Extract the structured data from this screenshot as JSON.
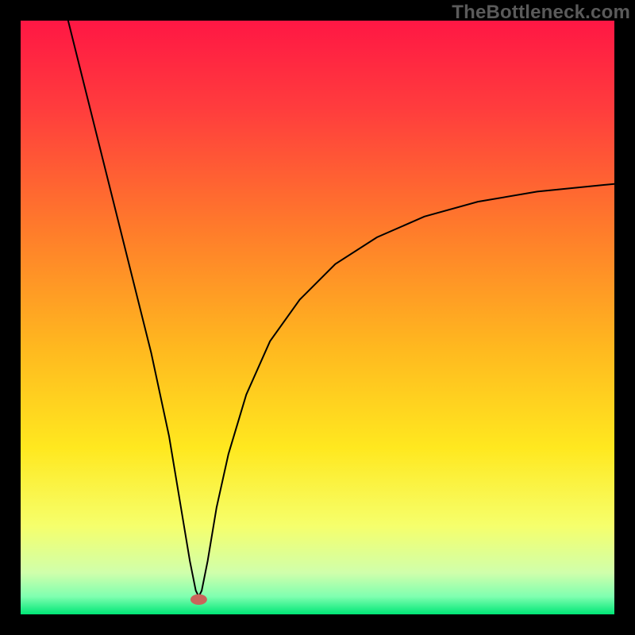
{
  "watermark": "TheBottleneck.com",
  "chart_data": {
    "type": "line",
    "title": "",
    "xlabel": "",
    "ylabel": "",
    "x_range": [
      0,
      100
    ],
    "y_range": [
      0,
      100
    ],
    "background": {
      "type": "vertical_gradient",
      "stops": [
        {
          "pos": 0.0,
          "color": "#ff1744"
        },
        {
          "pos": 0.15,
          "color": "#ff3d3d"
        },
        {
          "pos": 0.35,
          "color": "#ff7b2b"
        },
        {
          "pos": 0.55,
          "color": "#ffb81f"
        },
        {
          "pos": 0.72,
          "color": "#ffe81f"
        },
        {
          "pos": 0.85,
          "color": "#f6ff6b"
        },
        {
          "pos": 0.93,
          "color": "#d0ffab"
        },
        {
          "pos": 0.97,
          "color": "#7fffb0"
        },
        {
          "pos": 1.0,
          "color": "#00e676"
        }
      ]
    },
    "curve": {
      "note": "V-shaped curve; vertex near x≈30, y≈3. Left branch rises to top-left corner; right branch rises asymptotically toward ~70% height at right edge.",
      "points": [
        {
          "x": 8.0,
          "y": 100.0
        },
        {
          "x": 10.0,
          "y": 92.0
        },
        {
          "x": 13.0,
          "y": 80.0
        },
        {
          "x": 16.0,
          "y": 68.0
        },
        {
          "x": 19.0,
          "y": 56.0
        },
        {
          "x": 22.0,
          "y": 44.0
        },
        {
          "x": 25.0,
          "y": 30.0
        },
        {
          "x": 27.0,
          "y": 18.0
        },
        {
          "x": 28.5,
          "y": 9.0
        },
        {
          "x": 29.5,
          "y": 4.0
        },
        {
          "x": 30.0,
          "y": 3.0
        },
        {
          "x": 30.5,
          "y": 4.0
        },
        {
          "x": 31.5,
          "y": 9.0
        },
        {
          "x": 33.0,
          "y": 18.0
        },
        {
          "x": 35.0,
          "y": 27.0
        },
        {
          "x": 38.0,
          "y": 37.0
        },
        {
          "x": 42.0,
          "y": 46.0
        },
        {
          "x": 47.0,
          "y": 53.0
        },
        {
          "x": 53.0,
          "y": 59.0
        },
        {
          "x": 60.0,
          "y": 63.5
        },
        {
          "x": 68.0,
          "y": 67.0
        },
        {
          "x": 77.0,
          "y": 69.5
        },
        {
          "x": 87.0,
          "y": 71.2
        },
        {
          "x": 100.0,
          "y": 72.5
        }
      ]
    },
    "marker": {
      "x": 30.0,
      "y": 2.5,
      "rx": 1.4,
      "ry": 0.9,
      "color": "#c9645a"
    }
  }
}
